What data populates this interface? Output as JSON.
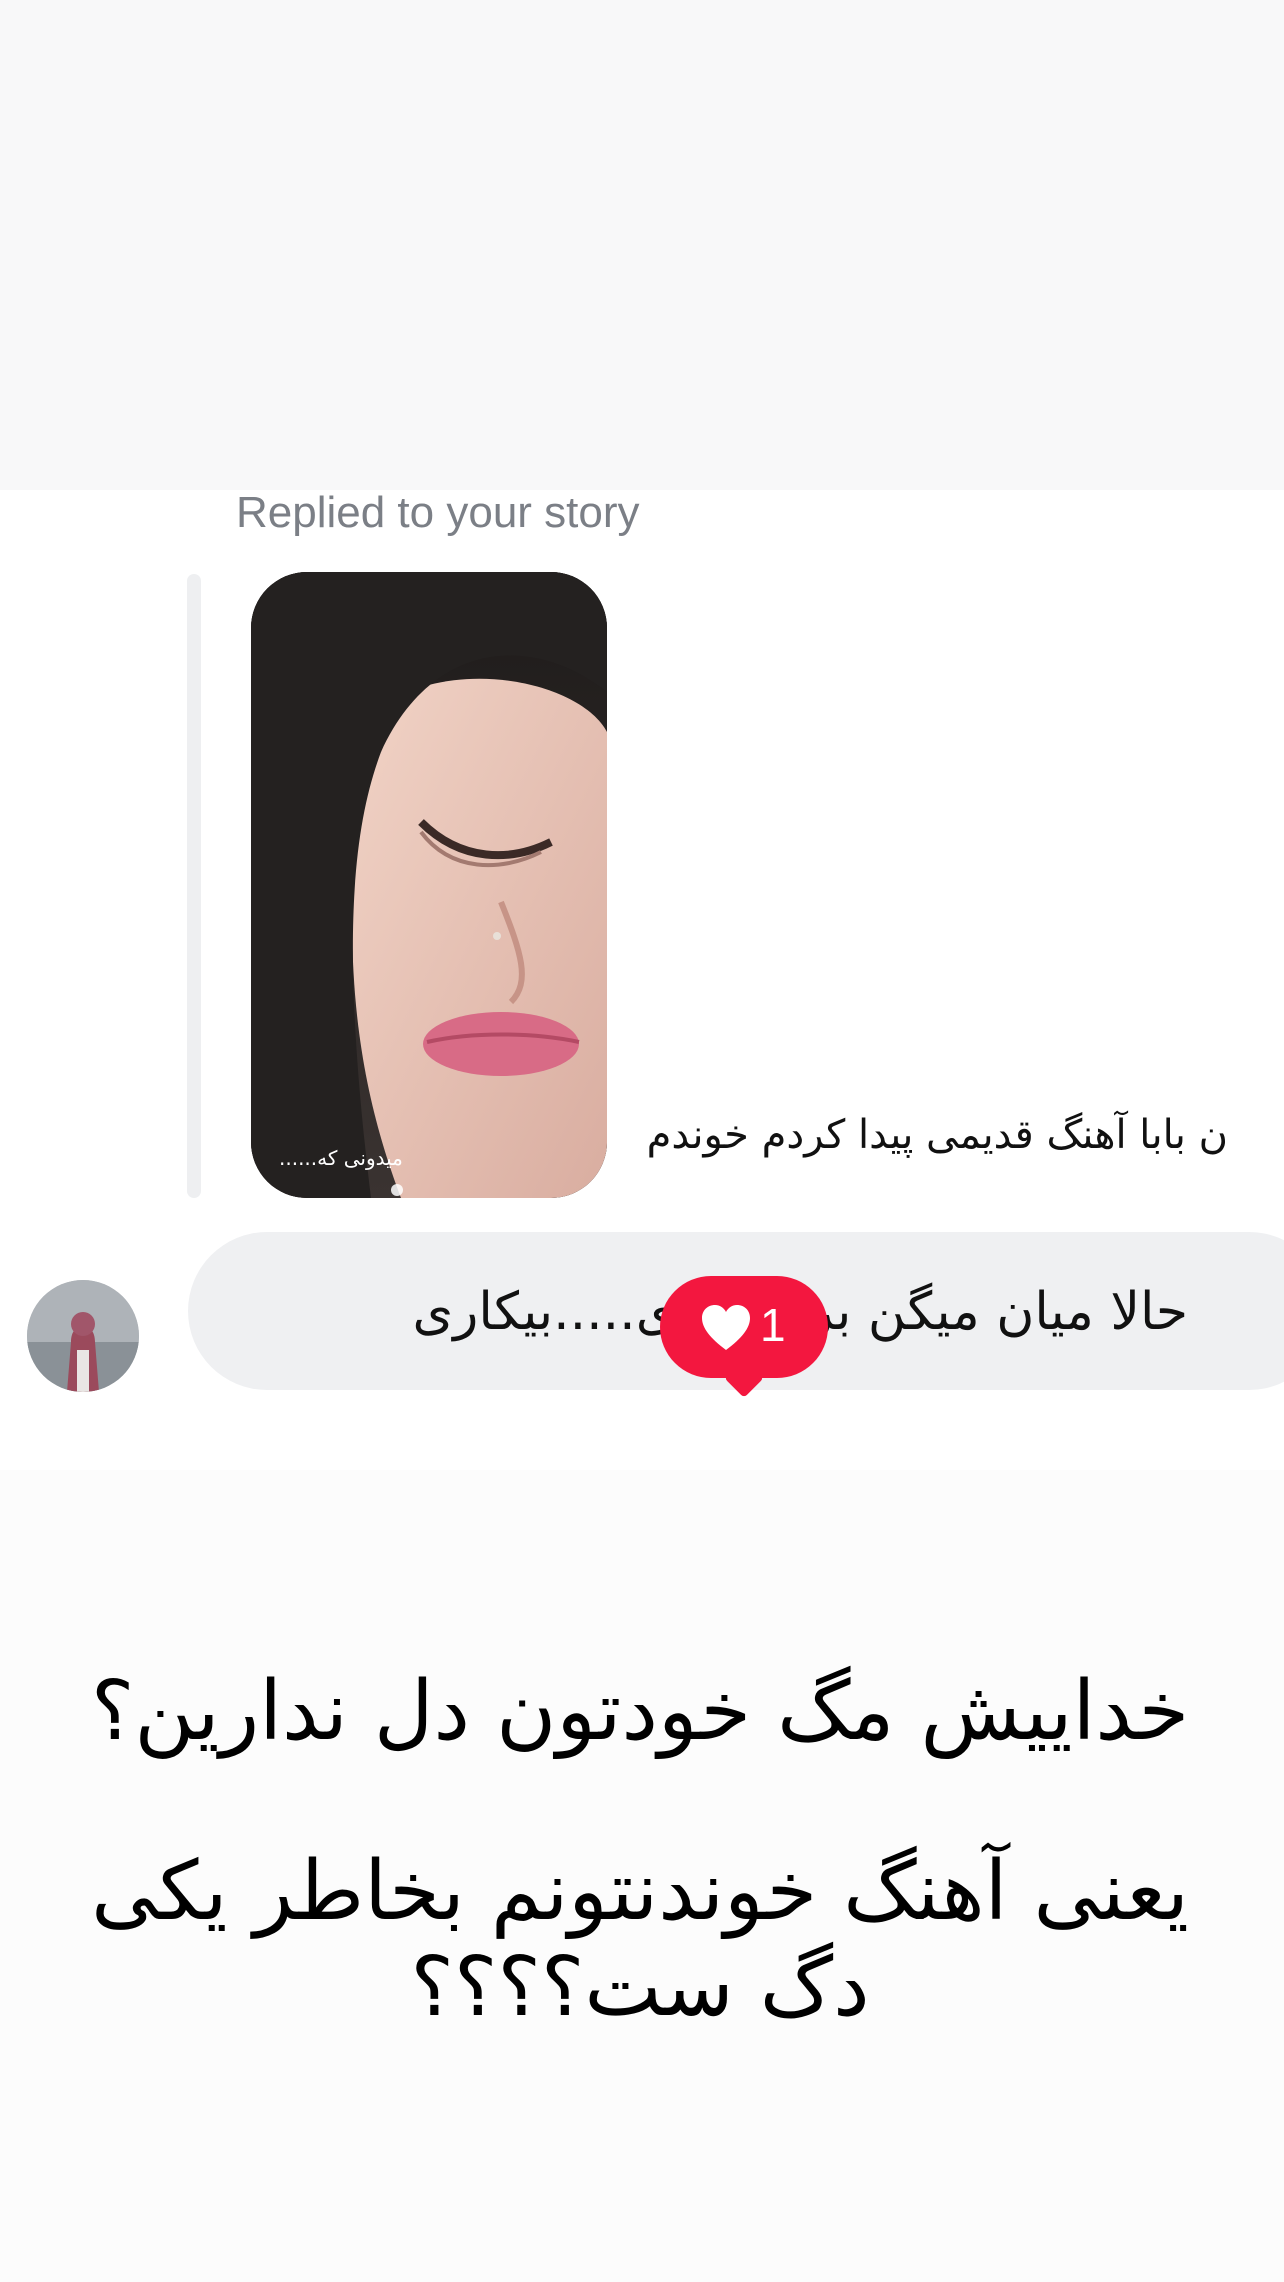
{
  "reply": {
    "label": "Replied to your story"
  },
  "story": {
    "caption": "میدونی که......"
  },
  "overlay_line": "ن بابا آهنگ قدیمی پیدا کردم خوندم",
  "message": {
    "text": "حالا میان میگن برا خوندی.....بیکاری",
    "reaction_count": "1",
    "reaction_color": "#f3173f",
    "reaction_icon": "heart-icon"
  },
  "big_text": {
    "line1": "خداییش مگ خودتون دل ندارین؟",
    "line2": "یعنی آهنگ خوندنتونم بخاطر یکی دگ ست؟؟؟؟"
  }
}
